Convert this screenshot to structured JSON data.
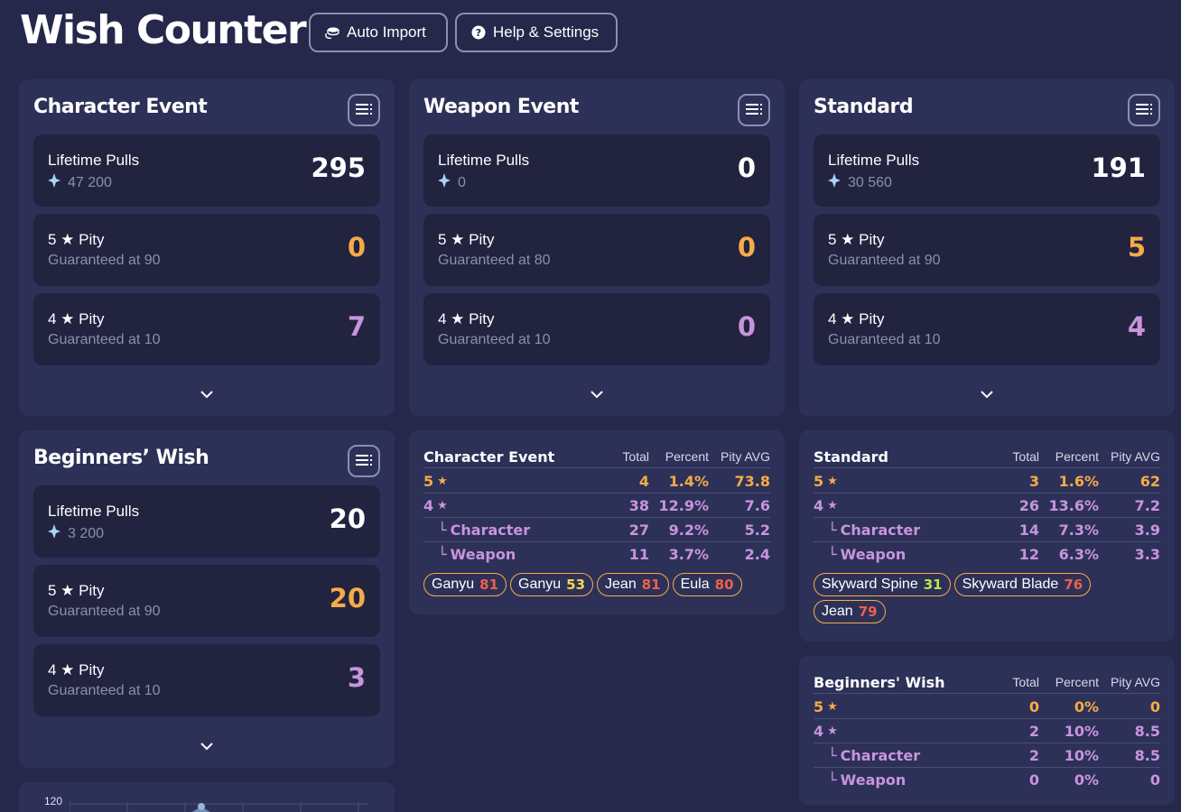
{
  "header": {
    "title": "Wish Counter",
    "auto_import_label": "Auto Import",
    "help_label": "Help & Settings"
  },
  "colors": {
    "accent_orange": "#f6ab47",
    "accent_purple": "#c894dd",
    "panel": "#2d3158",
    "card": "#21233f"
  },
  "banners": {
    "character": {
      "title": "Character Event",
      "lifetime_label": "Lifetime Pulls",
      "primogems": "47 200",
      "lifetime_value": "295",
      "pity5_label": "5 ★ Pity",
      "pity5_sub": "Guaranteed at 90",
      "pity5_value": "0",
      "pity4_label": "4 ★ Pity",
      "pity4_sub": "Guaranteed at 10",
      "pity4_value": "7"
    },
    "weapon": {
      "title": "Weapon Event",
      "lifetime_label": "Lifetime Pulls",
      "primogems": "0",
      "lifetime_value": "0",
      "pity5_label": "5 ★ Pity",
      "pity5_sub": "Guaranteed at 80",
      "pity5_value": "0",
      "pity4_label": "4 ★ Pity",
      "pity4_sub": "Guaranteed at 10",
      "pity4_value": "0"
    },
    "standard": {
      "title": "Standard",
      "lifetime_label": "Lifetime Pulls",
      "primogems": "30 560",
      "lifetime_value": "191",
      "pity5_label": "5 ★ Pity",
      "pity5_sub": "Guaranteed at 90",
      "pity5_value": "5",
      "pity4_label": "4 ★ Pity",
      "pity4_sub": "Guaranteed at 10",
      "pity4_value": "4"
    },
    "beginners": {
      "title": "Beginners’ Wish",
      "lifetime_label": "Lifetime Pulls",
      "primogems": "3 200",
      "lifetime_value": "20",
      "pity5_label": "5 ★ Pity",
      "pity5_sub": "Guaranteed at 90",
      "pity5_value": "20",
      "pity4_label": "4 ★ Pity",
      "pity4_sub": "Guaranteed at 10",
      "pity4_value": "3"
    }
  },
  "stats": {
    "columns": {
      "total": "Total",
      "percent": "Percent",
      "pity_avg": "Pity AVG"
    },
    "character": {
      "title": "Character Event",
      "rows": [
        {
          "name": "5",
          "total": "4",
          "percent": "1.4%",
          "avg": "73.8"
        },
        {
          "name": "4",
          "total": "38",
          "percent": "12.9%",
          "avg": "7.6"
        },
        {
          "name": "Character",
          "total": "27",
          "percent": "9.2%",
          "avg": "5.2"
        },
        {
          "name": "Weapon",
          "total": "11",
          "percent": "3.7%",
          "avg": "2.4"
        }
      ],
      "chips": [
        {
          "name": "Ganyu",
          "pity": "81",
          "color": "#f0604a"
        },
        {
          "name": "Ganyu",
          "pity": "53",
          "color": "#f5d84a"
        },
        {
          "name": "Jean",
          "pity": "81",
          "color": "#f0604a"
        },
        {
          "name": "Eula",
          "pity": "80",
          "color": "#f0604a"
        }
      ]
    },
    "standard": {
      "title": "Standard",
      "rows": [
        {
          "name": "5",
          "total": "3",
          "percent": "1.6%",
          "avg": "62"
        },
        {
          "name": "4",
          "total": "26",
          "percent": "13.6%",
          "avg": "7.2"
        },
        {
          "name": "Character",
          "total": "14",
          "percent": "7.3%",
          "avg": "3.9"
        },
        {
          "name": "Weapon",
          "total": "12",
          "percent": "6.3%",
          "avg": "3.3"
        }
      ],
      "chips": [
        {
          "name": "Skyward Spine",
          "pity": "31",
          "color": "#b6e84a"
        },
        {
          "name": "Skyward Blade",
          "pity": "76",
          "color": "#f0604a"
        },
        {
          "name": "Jean",
          "pity": "79",
          "color": "#f0604a"
        }
      ]
    },
    "beginners": {
      "title": "Beginners' Wish",
      "rows": [
        {
          "name": "5",
          "total": "0",
          "percent": "0%",
          "avg": "0"
        },
        {
          "name": "4",
          "total": "2",
          "percent": "10%",
          "avg": "8.5"
        },
        {
          "name": "Character",
          "total": "2",
          "percent": "10%",
          "avg": "8.5"
        },
        {
          "name": "Weapon",
          "total": "0",
          "percent": "0%",
          "avg": "0"
        }
      ]
    }
  },
  "chart": {
    "tick_top": "120"
  }
}
